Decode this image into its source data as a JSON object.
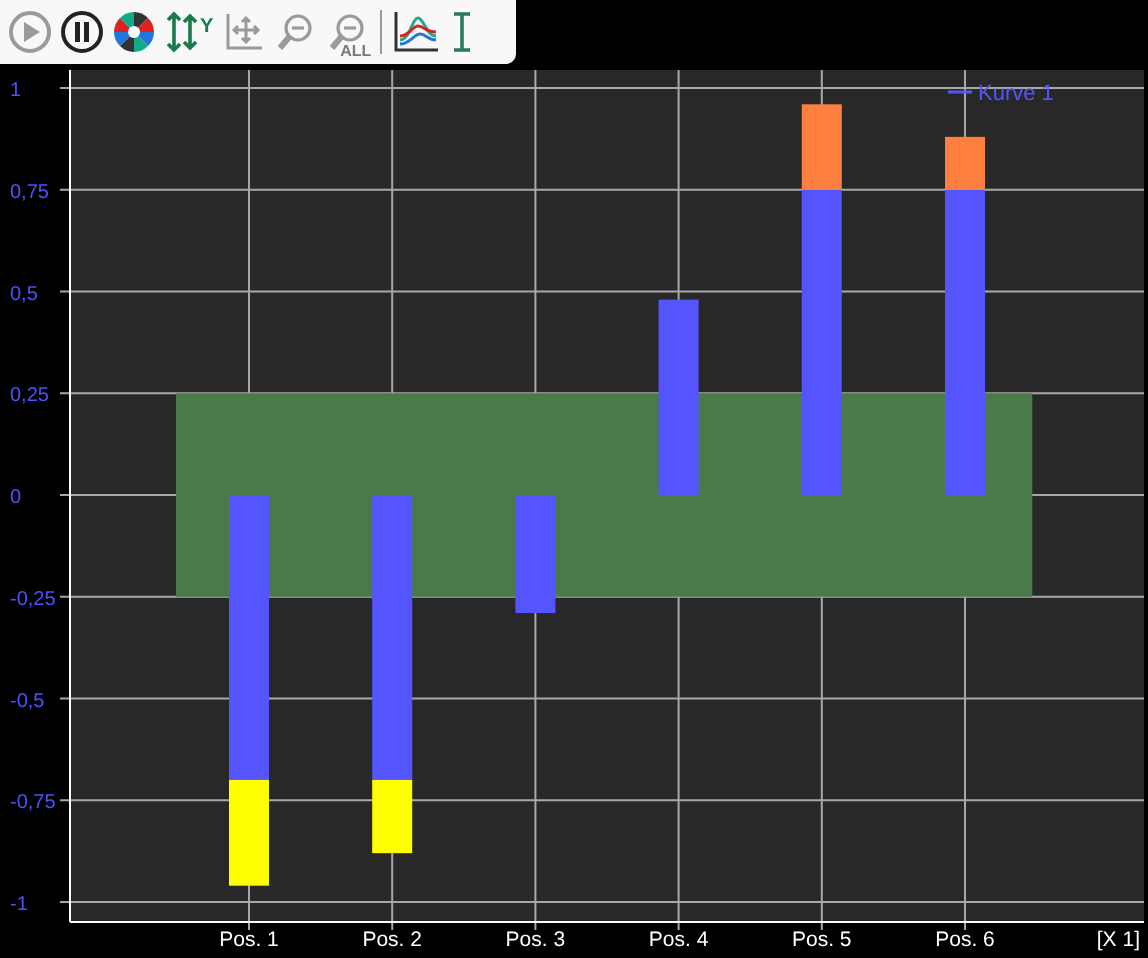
{
  "toolbar": [
    {
      "kind": "play",
      "disabled": true
    },
    {
      "kind": "pause",
      "disabled": false
    },
    {
      "kind": "colors",
      "disabled": false
    },
    {
      "kind": "scale_y",
      "label": "Y",
      "disabled": false
    },
    {
      "kind": "pan",
      "disabled": true
    },
    {
      "kind": "zoom_out",
      "disabled": true
    },
    {
      "kind": "zoom_all",
      "label": "ALL",
      "disabled": true
    },
    {
      "kind": "curves",
      "disabled": false
    },
    {
      "kind": "cursor",
      "disabled": false
    }
  ],
  "chart": {
    "chart_data": {
      "type": "bar",
      "stacked": true,
      "xlabel": "[X 1]",
      "categories": [
        "Pos. 1",
        "Pos. 2",
        "Pos. 3",
        "Pos. 4",
        "Pos. 5",
        "Pos. 6"
      ],
      "series": [
        {
          "name": "Kurve 1",
          "color": "#5555ff",
          "values": [
            -0.7,
            -0.7,
            -0.29,
            0.48,
            0.75,
            0.75
          ]
        },
        {
          "color": "#ffff00",
          "values": [
            -0.26,
            -0.18,
            null,
            null,
            null,
            null
          ]
        },
        {
          "color": "#ff7f3f",
          "values": [
            null,
            null,
            null,
            null,
            0.21,
            0.13
          ]
        }
      ],
      "ylim": [
        -1,
        1
      ],
      "yticks": [
        {
          "value": 1,
          "label": "1"
        },
        {
          "value": 0.75,
          "label": "0,75"
        },
        {
          "value": 0.5,
          "label": "0,5"
        },
        {
          "value": 0.25,
          "label": "0,25"
        },
        {
          "value": 0,
          "label": "0"
        },
        {
          "value": -0.25,
          "label": "-0,25"
        },
        {
          "value": -0.5,
          "label": "-0,5"
        },
        {
          "value": -0.75,
          "label": "-0,75"
        },
        {
          "value": -1,
          "label": "-1"
        }
      ],
      "grid": true,
      "bands": [
        {
          "axis": "y",
          "from": -0.25,
          "to": 0.25,
          "color": "#4a7a4a"
        }
      ]
    }
  }
}
